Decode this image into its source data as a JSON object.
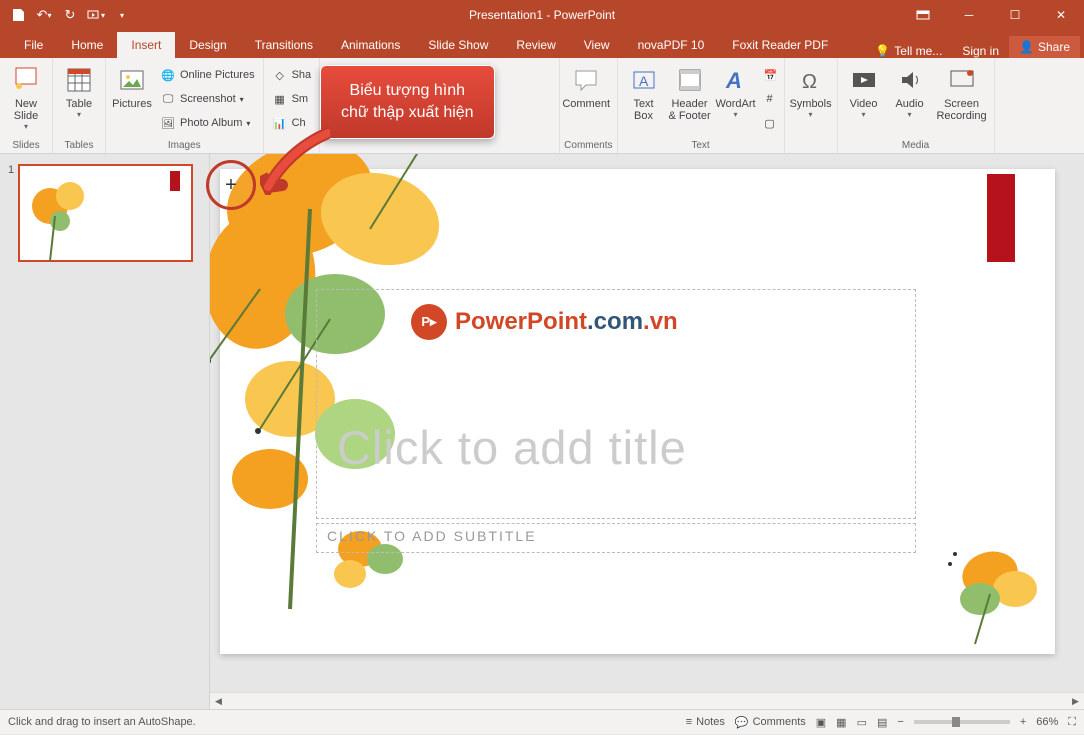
{
  "app_title": "Presentation1 - PowerPoint",
  "tabs": {
    "file": "File",
    "home": "Home",
    "insert": "Insert",
    "design": "Design",
    "transitions": "Transitions",
    "animations": "Animations",
    "slideshow": "Slide Show",
    "review": "Review",
    "view": "View",
    "novapdf": "novaPDF 10",
    "foxit": "Foxit Reader PDF",
    "tellme": "Tell me...",
    "signin": "Sign in",
    "share": "Share"
  },
  "ribbon": {
    "new_slide": "New\nSlide",
    "table": "Table",
    "pictures": "Pictures",
    "online_pics": "Online Pictures",
    "screenshot": "Screenshot",
    "photo_album": "Photo Album",
    "shapes": "Sha",
    "smartart": "Sm",
    "chart": "Ch",
    "comment": "Comment",
    "text_box": "Text\nBox",
    "header_footer": "Header\n& Footer",
    "wordart": "WordArt",
    "symbols": "Symbols",
    "video": "Video",
    "audio": "Audio",
    "screen_rec": "Screen\nRecording",
    "grp_slides": "Slides",
    "grp_tables": "Tables",
    "grp_images": "Images",
    "grp_comments": "Comments",
    "grp_text": "Text",
    "grp_media": "Media"
  },
  "slide": {
    "number": "1",
    "logo_main": "PowerPoint",
    "logo_dom1": ".com",
    "logo_dom2": ".vn",
    "title_placeholder": "Click to add title",
    "subtitle_placeholder": "CLICK TO ADD SUBTITLE"
  },
  "callout_text": "Biểu tượng hình\nchữ thập xuất hiện",
  "status": {
    "left": "Click and drag to insert an AutoShape.",
    "notes": "Notes",
    "comments": "Comments",
    "zoom": "66%"
  }
}
